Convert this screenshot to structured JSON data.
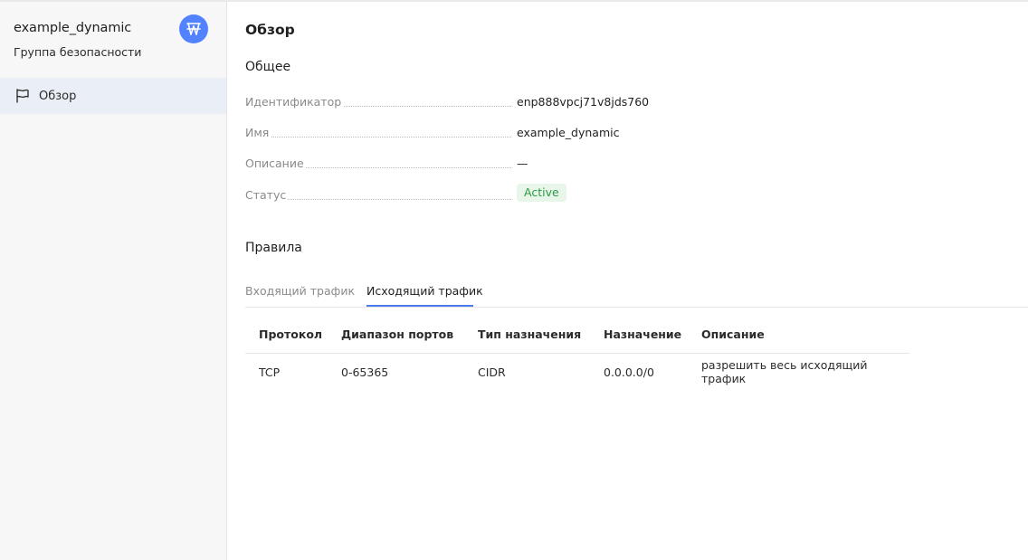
{
  "sidebar": {
    "title": "example_dynamic",
    "subtitle": "Группа безопасности",
    "badge_icon": "security-group-icon",
    "badge_color": "#5282ff",
    "nav": [
      {
        "label": "Обзор",
        "icon": "flag-icon",
        "active": true
      }
    ]
  },
  "main": {
    "title": "Обзор",
    "general": {
      "heading": "Общее",
      "fields": [
        {
          "key": "Идентификатор",
          "value": "enp888vpcj71v8jds760"
        },
        {
          "key": "Имя",
          "value": "example_dynamic"
        },
        {
          "key": "Описание",
          "value": "—"
        },
        {
          "key": "Статус",
          "value": "Active"
        }
      ],
      "status_color": "#2c9a44"
    },
    "rules": {
      "heading": "Правила",
      "tabs": [
        {
          "label": "Входящий трафик",
          "active": false
        },
        {
          "label": "Исходящий трафик",
          "active": true
        }
      ],
      "columns": [
        "Протокол",
        "Диапазон портов",
        "Тип назначения",
        "Назначение",
        "Описание"
      ],
      "rows": [
        [
          "TCP",
          "0-65365",
          "CIDR",
          "0.0.0.0/0",
          "разрешить весь исходящий трафик"
        ]
      ]
    }
  },
  "accent_color": "#4b7bec"
}
